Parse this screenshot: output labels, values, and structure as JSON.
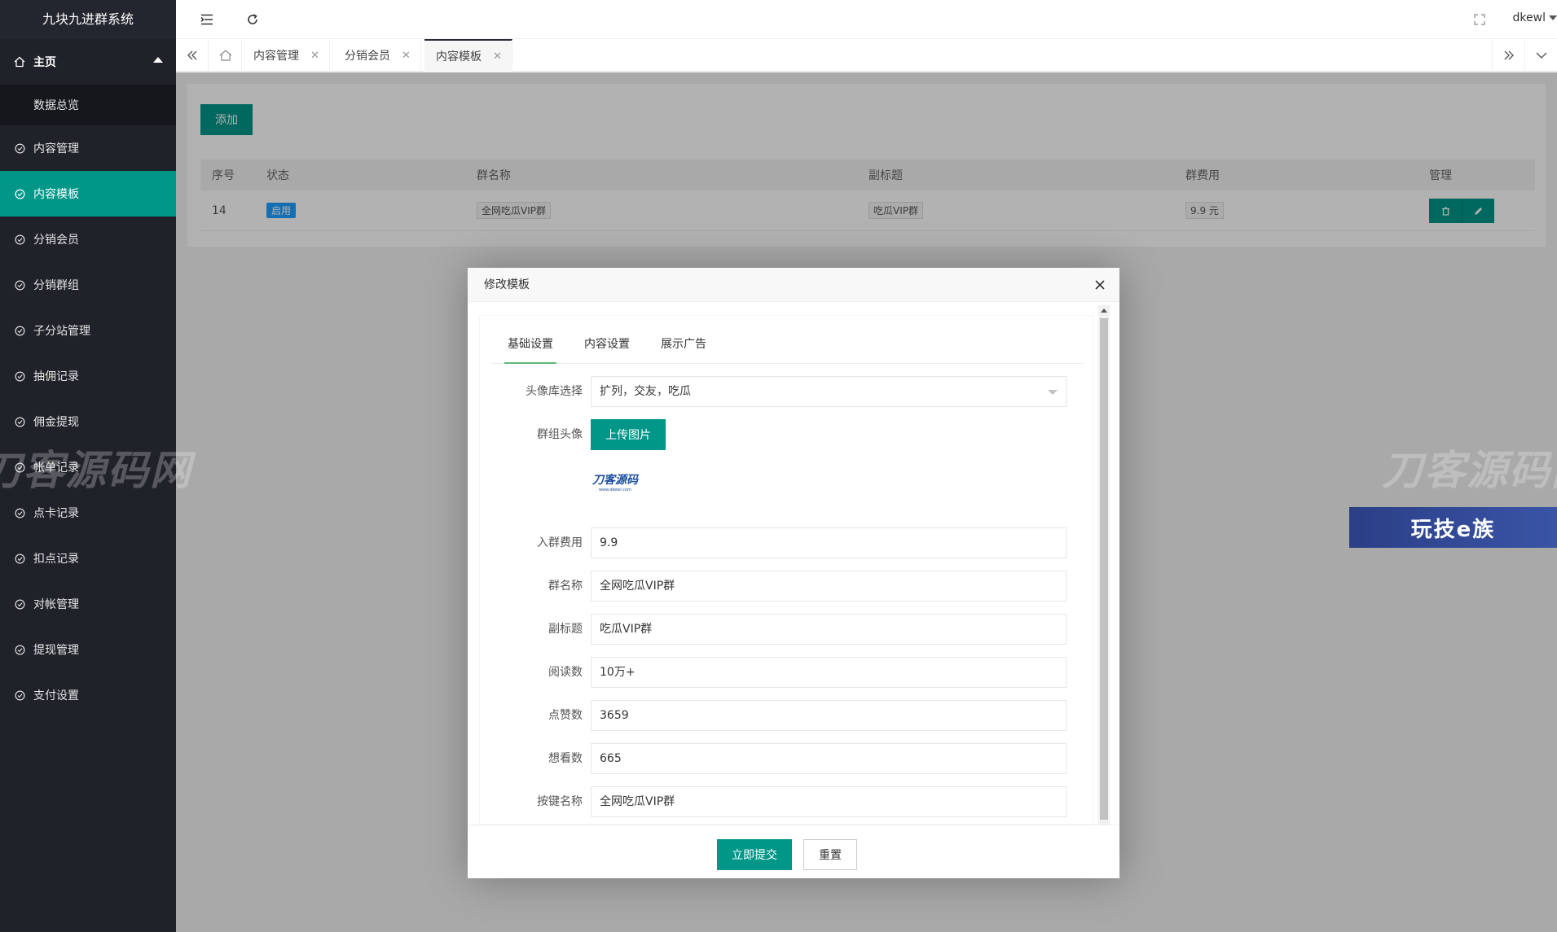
{
  "app": {
    "title": "九块九进群系统"
  },
  "sidebar": {
    "home": "主页",
    "sub": "数据总览",
    "items": [
      {
        "label": "内容管理"
      },
      {
        "label": "内容模板"
      },
      {
        "label": "分销会员"
      },
      {
        "label": "分销群组"
      },
      {
        "label": "子分站管理"
      },
      {
        "label": "抽佣记录"
      },
      {
        "label": "佣金提现"
      },
      {
        "label": "帐单记录"
      },
      {
        "label": "点卡记录"
      },
      {
        "label": "扣点记录"
      },
      {
        "label": "对帐管理"
      },
      {
        "label": "提现管理"
      },
      {
        "label": "支付设置"
      }
    ]
  },
  "header": {
    "user": "dkewl"
  },
  "tabs": [
    {
      "label": "内容管理"
    },
    {
      "label": "分销会员"
    },
    {
      "label": "内容模板"
    }
  ],
  "toolbar": {
    "add_label": "添加"
  },
  "table": {
    "headers": [
      "序号",
      "状态",
      "群名称",
      "副标题",
      "群费用",
      "管理"
    ],
    "rows": [
      {
        "id": "14",
        "status": "启用",
        "name": "全网吃瓜VIP群",
        "subtitle": "吃瓜VIP群",
        "fee": "9.9 元"
      }
    ]
  },
  "watermark": {
    "text": "刀客源码网",
    "promo": "玩技e族"
  },
  "modal": {
    "title": "修改模板",
    "tabs": [
      "基础设置",
      "内容设置",
      "展示广告"
    ],
    "fields": {
      "avatar_lib": {
        "label": "头像库选择",
        "value": "扩列，交友，吃瓜"
      },
      "group_avatar": {
        "label": "群组头像",
        "button": "上传图片",
        "thumb_text": "刀客源码",
        "thumb_sub": "www.dkewl.com"
      },
      "fee": {
        "label": "入群费用",
        "value": "9.9"
      },
      "name": {
        "label": "群名称",
        "value": "全网吃瓜VIP群"
      },
      "subtitle": {
        "label": "副标题",
        "value": "吃瓜VIP群"
      },
      "reads": {
        "label": "阅读数",
        "value": "10万+"
      },
      "likes": {
        "label": "点赞数",
        "value": "3659"
      },
      "wants": {
        "label": "想看数",
        "value": "665"
      },
      "button_name": {
        "label": "按键名称",
        "value": "全网吃瓜VIP群"
      }
    },
    "submit": "立即提交",
    "reset": "重置"
  },
  "colors": {
    "accent": "#009688",
    "sidebar": "#20222a",
    "badge": "#1e9fff"
  }
}
